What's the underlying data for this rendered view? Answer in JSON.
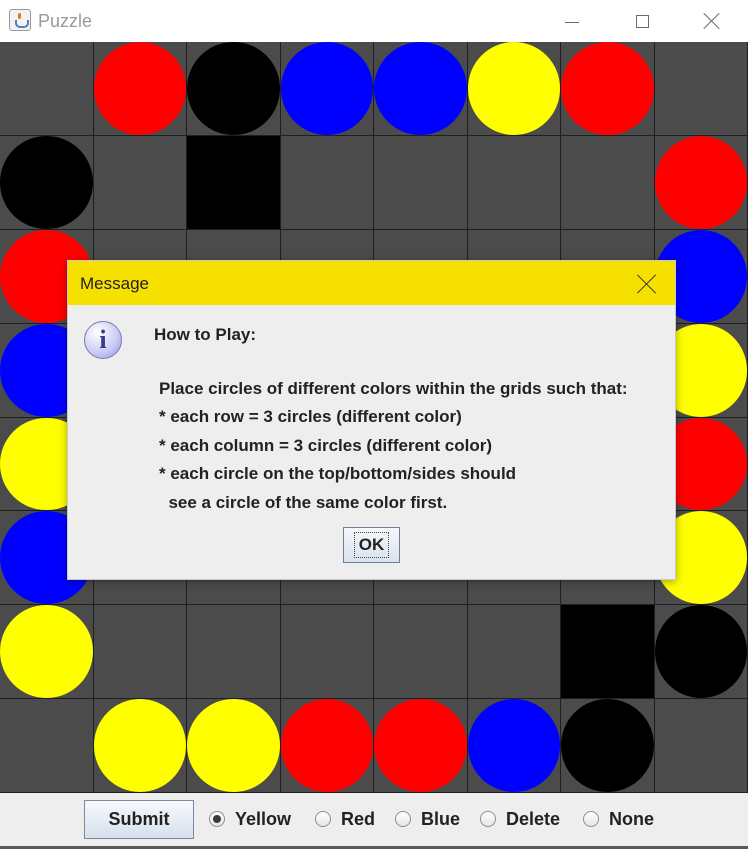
{
  "window": {
    "title": "Puzzle",
    "icon": "java-cup-icon",
    "controls": [
      "minimize-icon",
      "maximize-icon",
      "close-icon"
    ]
  },
  "board": {
    "rows": 8,
    "cols": 8,
    "colors": {
      "R": "#ff0000",
      "K": "#000000",
      "B": "#0000ff",
      "Y": "#ffff00",
      "background": "#4b4b4b",
      "gridline": "#1f1f1f"
    },
    "grid": [
      [
        ".",
        "R",
        "K",
        "B",
        "B",
        "Y",
        "R",
        "."
      ],
      [
        "K",
        ".",
        "#",
        ".",
        ".",
        ".",
        ".",
        "R"
      ],
      [
        "R",
        ".",
        ".",
        ".",
        ".",
        ".",
        ".",
        "B"
      ],
      [
        "B",
        ".",
        ".",
        ".",
        ".",
        ".",
        ".",
        "Y"
      ],
      [
        "Y",
        ".",
        ".",
        ".",
        ".",
        ".",
        ".",
        "R"
      ],
      [
        "B",
        ".",
        ".",
        ".",
        ".",
        ".",
        ".",
        "Y"
      ],
      [
        "Y",
        ".",
        ".",
        ".",
        ".",
        ".",
        "#",
        "K"
      ],
      [
        ".",
        "Y",
        "Y",
        "R",
        "R",
        "B",
        "K",
        "."
      ]
    ],
    "legend": {
      ".": "empty",
      "#": "blocked-black-square",
      "R": "red-circle",
      "K": "black-circle",
      "B": "blue-circle",
      "Y": "yellow-circle"
    }
  },
  "dialog": {
    "title": "Message",
    "titlebar_color": "#f6e000",
    "icon": "info-icon",
    "heading": "How to Play:",
    "lines": [
      "Place circles of different colors within the grids such that:",
      "* each row = 3 circles (different color)",
      "* each column = 3 circles (different color)",
      "* each circle on the top/bottom/sides should",
      "  see a circle of the same color first."
    ],
    "ok_label": "OK"
  },
  "controls": {
    "submit_label": "Submit",
    "options": [
      {
        "label": "Yellow",
        "checked": true
      },
      {
        "label": "Red",
        "checked": false
      },
      {
        "label": "Blue",
        "checked": false
      },
      {
        "label": "Delete",
        "checked": false
      },
      {
        "label": "None",
        "checked": false
      }
    ]
  }
}
